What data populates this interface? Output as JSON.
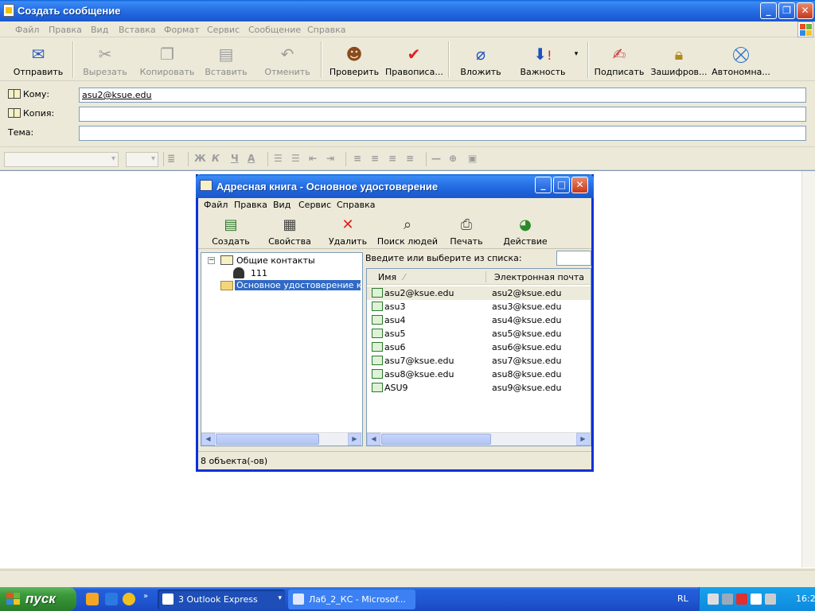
{
  "window": {
    "title": "Создать сообщение",
    "controls": {
      "minimize": "_",
      "maximize": "❐",
      "close": "✕"
    }
  },
  "menu": [
    "Файл",
    "Правка",
    "Вид",
    "Вставка",
    "Формат",
    "Сервис",
    "Сообщение",
    "Справка"
  ],
  "toolbar": {
    "send": "Отправить",
    "cut": "Вырезать",
    "copy": "Копировать",
    "paste": "Вставить",
    "undo": "Отменить",
    "check": "Проверить",
    "spelling": "Правописа...",
    "attach": "Вложить",
    "priority": "Важность",
    "sign": "Подписать",
    "encrypt": "Зашифров...",
    "offline": "Автономна..."
  },
  "header_fields": {
    "to_label": "Кому:",
    "to_value": "asu2@ksue.edu",
    "cc_label": "Копия:",
    "cc_value": "",
    "subject_label": "Тема:",
    "subject_value": ""
  },
  "format_bar": {
    "bold": "Ж",
    "italic": "К",
    "underline": "Ч",
    "font_color": "А"
  },
  "address_book": {
    "title": "Адресная книга - Основное удостоверение",
    "menu": [
      "Файл",
      "Правка",
      "Вид",
      "Сервис",
      "Справка"
    ],
    "toolbar": {
      "create": "Создать",
      "properties": "Свойства",
      "delete": "Удалить",
      "find_people": "Поиск людей",
      "print": "Печать",
      "action": "Действие"
    },
    "tree": {
      "shared_contacts": "Общие контакты",
      "child": "111",
      "main_identity": "Основное удостоверение конт"
    },
    "search_label": "Введите или выберите из списка:",
    "columns": {
      "name": "Имя",
      "email": "Электронная почта"
    },
    "contacts": [
      {
        "name": "asu2@ksue.edu",
        "email": "asu2@ksue.edu"
      },
      {
        "name": "asu3",
        "email": "asu3@ksue.edu"
      },
      {
        "name": "asu4",
        "email": "asu4@ksue.edu"
      },
      {
        "name": "asu5",
        "email": "asu5@ksue.edu"
      },
      {
        "name": "asu6",
        "email": "asu6@ksue.edu"
      },
      {
        "name": "asu7@ksue.edu",
        "email": "asu7@ksue.edu"
      },
      {
        "name": "asu8@ksue.edu",
        "email": "asu8@ksue.edu"
      },
      {
        "name": "ASU9",
        "email": "asu9@ksue.edu"
      }
    ],
    "status": "8 объекта(-ов)"
  },
  "taskbar": {
    "start": "пуск",
    "tasks": [
      {
        "label": "3 Outlook Express"
      },
      {
        "label": "Лаб_2_КС - Microsof..."
      }
    ],
    "language": "RL",
    "clock": "16:2"
  }
}
